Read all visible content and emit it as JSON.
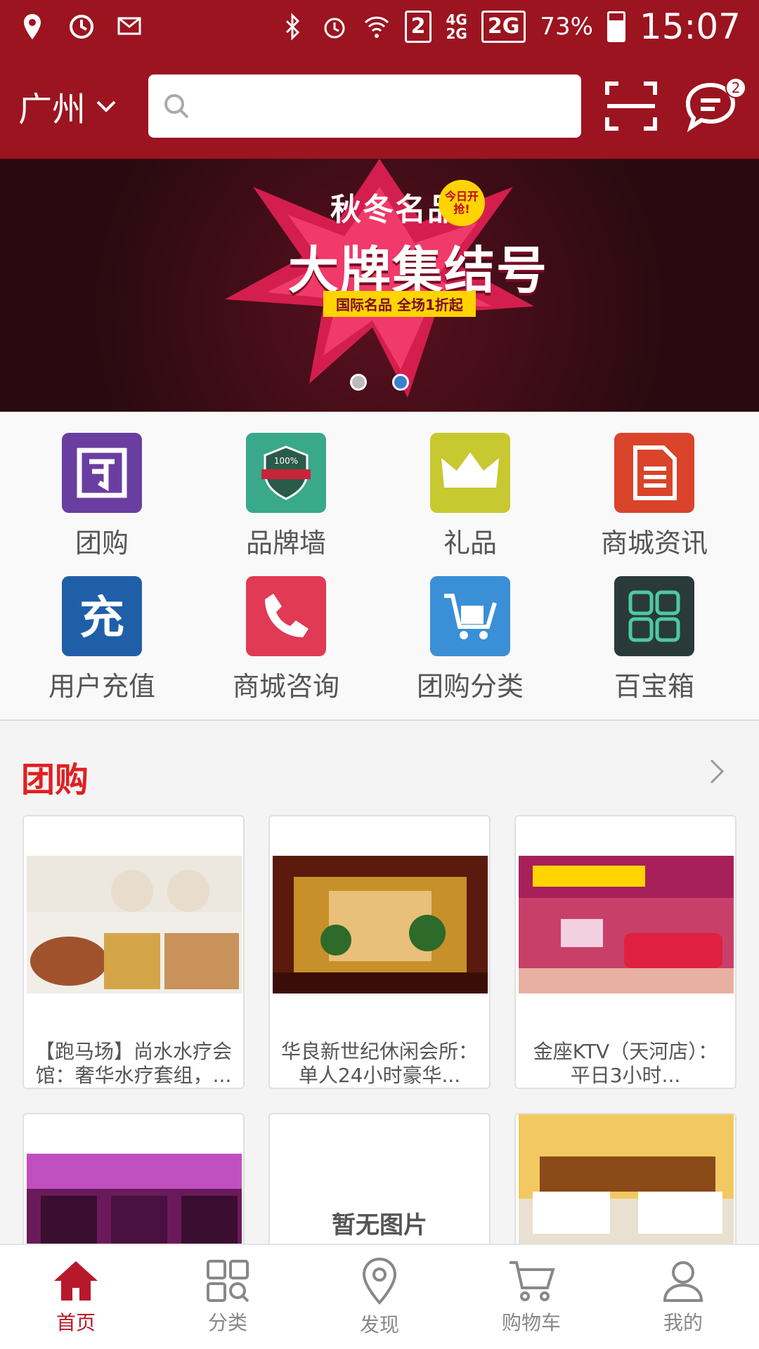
{
  "status_bar": {
    "network_a": "4G\n2G",
    "sim_slot": "2",
    "network_b": "2G",
    "battery_percent": "73%",
    "battery_level": 0.73,
    "time": "15:07"
  },
  "header": {
    "city": "广州",
    "search_placeholder": "",
    "message_count": "2"
  },
  "banner": {
    "line1": "秋冬名品",
    "line2": "大牌集结号",
    "tag": "今日开抢!",
    "strip": "国际名品 全场1折起",
    "slides": 2,
    "active_slide": 2
  },
  "grid": {
    "items": [
      {
        "label": "团购",
        "icon": "group-buy-icon",
        "color": "#6a3ea0"
      },
      {
        "label": "品牌墙",
        "icon": "brand-wall-icon",
        "color": "#3aa88a"
      },
      {
        "label": "礼品",
        "icon": "crown-icon",
        "color": "#c8c830"
      },
      {
        "label": "商城资讯",
        "icon": "document-icon",
        "color": "#d9442a"
      },
      {
        "label": "用户充值",
        "icon": "recharge-icon",
        "color": "#1f5fa8"
      },
      {
        "label": "商城咨询",
        "icon": "phone-icon",
        "color": "#e03a55"
      },
      {
        "label": "团购分类",
        "icon": "cart-icon",
        "color": "#3a8fd6"
      },
      {
        "label": "百宝箱",
        "icon": "toolbox-icon",
        "color": "#2a3a38"
      }
    ]
  },
  "group_section": {
    "title": "团购",
    "cards": [
      {
        "caption": "【跑马场】尚水水疗会馆：奢华水疗套组，...",
        "image": "restaurant-image"
      },
      {
        "caption": "华良新世纪休闲会所：单人24小时豪华...",
        "image": "spa-lobby-image"
      },
      {
        "caption": "金座KTV（天河店）：平日3小时...",
        "image": "ktv-image"
      },
      {
        "caption": "",
        "image": "ktv-pink-image"
      },
      {
        "caption": "",
        "image": "no-image",
        "noimg_text": "暂无图片"
      },
      {
        "caption": "",
        "image": "hotel-room-image"
      }
    ]
  },
  "tabbar": {
    "tabs": [
      {
        "label": "首页",
        "icon": "home-icon",
        "active": true
      },
      {
        "label": "分类",
        "icon": "category-icon",
        "active": false
      },
      {
        "label": "发现",
        "icon": "location-icon",
        "active": false
      },
      {
        "label": "购物车",
        "icon": "shopping-cart-icon",
        "active": false
      },
      {
        "label": "我的",
        "icon": "profile-icon",
        "active": false
      }
    ]
  },
  "colors": {
    "brand": "#9b1420",
    "accent_red": "#e02020",
    "active_tab": "#b8192a"
  }
}
